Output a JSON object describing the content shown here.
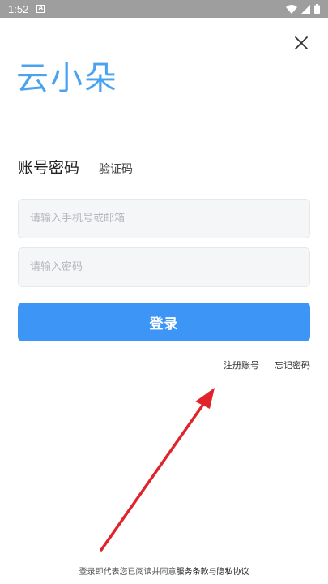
{
  "status_bar": {
    "time": "1:52",
    "notification_icon": "A"
  },
  "app": {
    "logo_text": "云小朵"
  },
  "tabs": {
    "password_login": "账号密码",
    "code_login": "验证码"
  },
  "form": {
    "account_placeholder": "请输入手机号或邮箱",
    "password_placeholder": "请输入密码",
    "login_label": "登录"
  },
  "links": {
    "register": "注册账号",
    "forgot_password": "忘记密码"
  },
  "footer": {
    "prefix": "登录即代表您已阅读并同意",
    "terms": "服务条款",
    "joiner": "与",
    "privacy": "隐私协议"
  },
  "colors": {
    "accent": "#3d95f5",
    "logo": "#4aa3f0",
    "annotation_arrow": "#e0242b"
  },
  "icons": [
    "wifi-icon",
    "signal-icon",
    "battery-icon",
    "close-icon"
  ]
}
